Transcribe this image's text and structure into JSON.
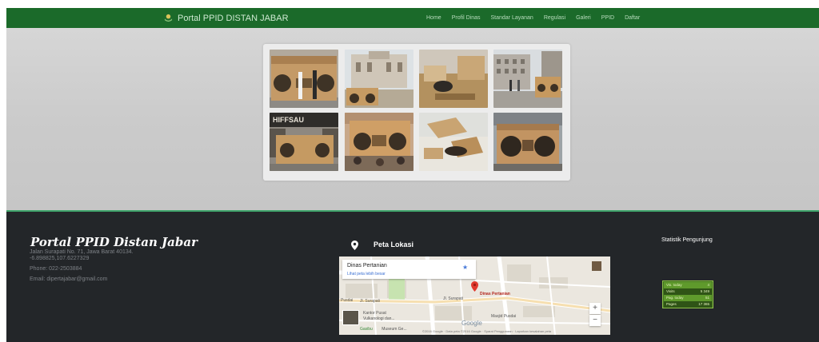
{
  "navbar": {
    "brand": "Portal PPID DISTAN JABAR",
    "menu": [
      "Home",
      "Profil Dinas",
      "Standar Layanan",
      "Regulasi",
      "Galeri",
      "PPID",
      "Daftar"
    ]
  },
  "gallery": {
    "photos": [
      "cardboard-boombox-on-street",
      "cardboard-boombox-opera-house",
      "assembling-cardboard-boombox",
      "cardboard-boombox-square",
      "cardboard-boombox-shop-front",
      "cardboard-boombox-crowd",
      "cardboard-pieces-table",
      "cardboard-boombox-closeup"
    ]
  },
  "footer": {
    "title": "Portal PPID Distan Jabar",
    "address_line1": "Jalan Surapati No. 71, Jawa Barat 40134.",
    "address_line2": "-6.898825,107.6227329",
    "phone": "Phone: 022-2503884",
    "email": "Email: dipertajabar@gmail.com",
    "map_heading": "Peta Lokasi",
    "stats_heading": "Statistik Pengunjung"
  },
  "map": {
    "card_title": "Dinas Pertanian",
    "card_link": "Lihat peta lebih besar",
    "marker_label": "Dinas Pertanian",
    "labels": {
      "street_left": "Jl. Surapati",
      "street_right": "Jl. Surapati",
      "prefix": "Pusdai",
      "poi1_line1": "Kantor Pusat",
      "poi1_line2": "Vulkanologi dan...",
      "poi2": "Masjid Pusdai",
      "gasibu": "Gasibu",
      "museum": "Museum Ge..."
    },
    "zoom_in": "+",
    "zoom_out": "−",
    "google": "Google",
    "attribution": "©2016 Google · Data peta ©2016 Google · Syarat Penggunaan · Laporkan kesalahan peta"
  },
  "stats": [
    {
      "label": "Vis. today",
      "value": "4"
    },
    {
      "label": "Visits",
      "value": "5 349"
    },
    {
      "label": "Pag. today",
      "value": "51"
    },
    {
      "label": "Pages",
      "value": "17 365"
    }
  ],
  "colors": {
    "navbar": "#1b6a2a",
    "footer": "#232629",
    "accent": "#3fa46b"
  }
}
